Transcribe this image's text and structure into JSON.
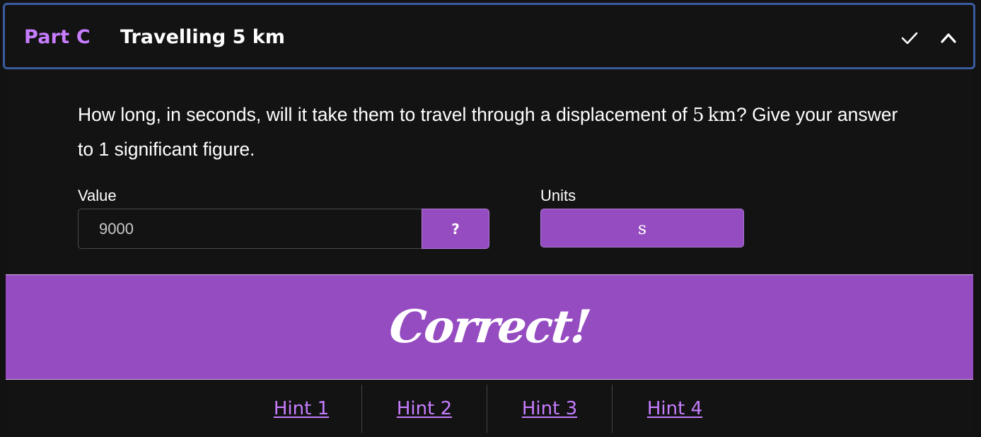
{
  "header": {
    "part_label": "Part C",
    "title": "Travelling 5 km",
    "status_icon": "check-icon",
    "toggle_icon": "chevron-up-icon"
  },
  "question": {
    "text_before": "How long, in seconds, will it take them to travel through a displacement of ",
    "math_value": "5",
    "math_unit": "km",
    "text_after": "? Give your answer to 1 significant figure."
  },
  "value_field": {
    "label": "Value",
    "value": "9000",
    "help_label": "?"
  },
  "units_field": {
    "label": "Units",
    "selected": "s"
  },
  "feedback": {
    "text": "Correct!"
  },
  "hints": [
    {
      "label": "Hint 1"
    },
    {
      "label": "Hint 2"
    },
    {
      "label": "Hint 3"
    },
    {
      "label": "Hint 4"
    }
  ],
  "colors": {
    "accent": "#954cc1",
    "accent_text": "#c77dff",
    "header_border": "#3a5ba0",
    "background": "#131313"
  }
}
